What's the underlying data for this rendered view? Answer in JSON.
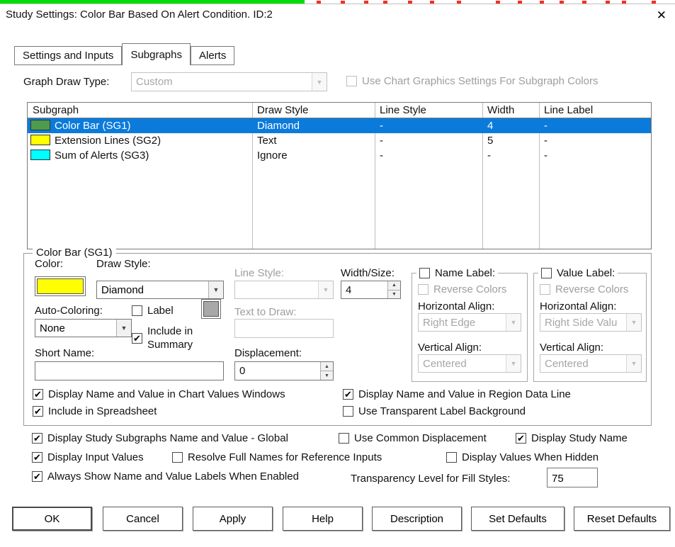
{
  "icons": {
    "close": "✕",
    "check": "✔",
    "dropdown": "▼",
    "spin_up": "▲",
    "spin_down": "▼"
  },
  "artifacts": {
    "green_bar_color": "#00dd04",
    "tick_color": "#fd2b20",
    "ticks": [
      447,
      481,
      514,
      541,
      576,
      607,
      645,
      700,
      731,
      762,
      790,
      822,
      855,
      878,
      920
    ]
  },
  "window": {
    "title": "Study Settings: Color Bar Based On Alert Condition. ID:2"
  },
  "tabs": [
    {
      "label": "Settings and Inputs"
    },
    {
      "label": "Subgraphs"
    },
    {
      "label": "Alerts"
    }
  ],
  "graph_draw_type": {
    "label": "Graph Draw Type:",
    "value": "Custom",
    "checkbox_label": "Use Chart Graphics Settings For Subgraph Colors"
  },
  "table": {
    "columns": [
      "Subgraph",
      "Draw Style",
      "Line Style",
      "Width",
      "Line Label"
    ],
    "selection_color": "#0b7bdb",
    "rows": [
      {
        "name": "Color Bar (SG1)",
        "swatch_color": "#4e9b50",
        "draw_style": "Diamond",
        "line_style": "-",
        "width": "4",
        "line_label": "-"
      },
      {
        "name": "Extension Lines (SG2)",
        "swatch_color": "#ffff00",
        "draw_style": "Text",
        "line_style": "-",
        "width": "5",
        "line_label": "-"
      },
      {
        "name": "Sum of Alerts (SG3)",
        "swatch_color": "#00ffff",
        "draw_style": "Ignore",
        "line_style": "-",
        "width": "-",
        "line_label": "-"
      }
    ]
  },
  "subgraph_group": {
    "title": "Color Bar (SG1)",
    "color_label": "Color:",
    "color_value": "#ffff00",
    "draw_style_label": "Draw Style:",
    "draw_style_value": "Diamond",
    "line_style_label": "Line Style:",
    "line_style_value": "",
    "width_size_label": "Width/Size:",
    "width_size_value": "4",
    "auto_coloring_label": "Auto-Coloring:",
    "auto_coloring_value": "None",
    "label_checkbox_label": "Label",
    "label_color_value": "#a8a8a8",
    "text_to_draw_label": "Text to Draw:",
    "text_to_draw_value": "",
    "include_in_summary_label": "Include in Summary",
    "short_name_label": "Short Name:",
    "short_name_value": "",
    "displacement_label": "Displacement:",
    "displacement_value": "0",
    "name_label_box": {
      "title": "Name Label:",
      "reverse_colors_label": "Reverse Colors",
      "horizontal_align_label": "Horizontal Align:",
      "horizontal_align_value": "Right Edge",
      "vertical_align_label": "Vertical Align:",
      "vertical_align_value": "Centered"
    },
    "value_label_box": {
      "title": "Value Label:",
      "reverse_colors_label": "Reverse Colors",
      "horizontal_align_label": "Horizontal Align:",
      "horizontal_align_value": "Right Side Valu",
      "vertical_align_label": "Vertical Align:",
      "vertical_align_value": "Centered"
    },
    "display_chart_values_label": "Display Name and Value in Chart Values Windows",
    "display_region_data_label": "Display Name and Value in Region Data Line",
    "include_spreadsheet_label": "Include in Spreadsheet",
    "transparent_background_label": "Use Transparent Label Background"
  },
  "global_options": {
    "subgraphs_global_label": "Display Study Subgraphs Name and Value - Global",
    "common_displacement_label": "Use Common Displacement",
    "display_study_name_label": "Display Study Name",
    "display_input_values_label": "Display Input Values",
    "resolve_full_names_label": "Resolve Full Names for Reference Inputs",
    "display_values_hidden_label": "Display Values When Hidden",
    "always_show_labels_label": "Always Show Name and Value Labels When Enabled",
    "transparency_label": "Transparency Level for Fill Styles:",
    "transparency_value": "75"
  },
  "buttons": [
    "OK",
    "Cancel",
    "Apply",
    "Help",
    "Description",
    "Set Defaults",
    "Reset Defaults"
  ]
}
